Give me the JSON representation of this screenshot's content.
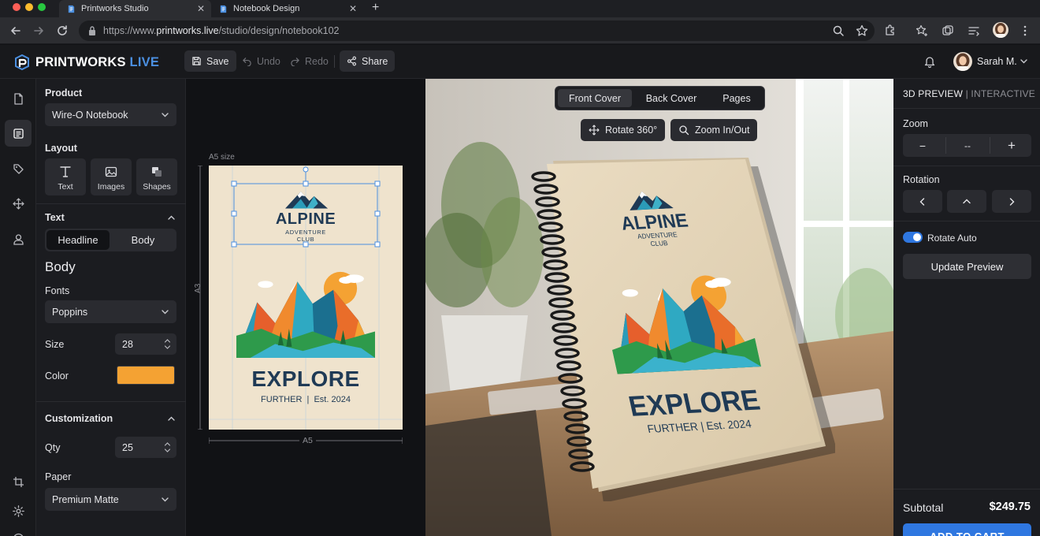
{
  "browser": {
    "tabs": [
      {
        "title": "Printworks Studio",
        "active": true
      },
      {
        "title": "Notebook Design",
        "active": false
      }
    ],
    "url_prefix": "https://www.",
    "url_host": "printworks.live",
    "url_path": "/studio/design/notebook102"
  },
  "header": {
    "logo_main": "PRINTWORKS",
    "logo_accent": "LIVE",
    "save": "Save",
    "undo": "Undo",
    "redo": "Redo",
    "share": "Share",
    "user_name": "Sarah M."
  },
  "props": {
    "product_label": "Product",
    "product_value": "Wire-O Notebook",
    "layout_label": "Layout",
    "tools": [
      "Text",
      "Images",
      "Shapes"
    ],
    "text_label": "Text",
    "segments": [
      "Headline",
      "Body"
    ],
    "selected_segment": "Headline",
    "style_heading": "Body",
    "fonts_label": "Fonts",
    "font_value": "Poppins",
    "size_label": "Size",
    "size_value": "28",
    "color_label": "Color",
    "color_value": "#f4a233",
    "customization_label": "Customization",
    "qty_label": "Qty",
    "qty_value": "25",
    "paper_label": "Paper",
    "paper_value": "Premium Matte"
  },
  "canvas": {
    "size_caption": "A5 size",
    "height_label": "A3",
    "width_label": "A5"
  },
  "design": {
    "brand_line1": "ALPINE",
    "brand_line2": "ADVENTURE",
    "brand_line3": "CLUB",
    "headline": "EXPLORE",
    "tagline": "FURTHER  |  Est. 2024"
  },
  "stage": {
    "view_tabs": [
      "Front Cover",
      "Back Cover",
      "Pages"
    ],
    "selected_view": "Front Cover",
    "rotate_button": "Rotate 360°",
    "zoom_button": "Zoom In/Out"
  },
  "preview_panel": {
    "title": "3D PREVIEW",
    "subtitle": "INTERACTIVE",
    "zoom_label": "Zoom",
    "zoom_minus": "−",
    "zoom_value": "--",
    "zoom_plus": "+",
    "rotation_label": "Rotation",
    "rotate_auto_label": "Rotate Auto",
    "rotate_auto_on": true,
    "update_button": "Update Preview",
    "subtotal_label": "Subtotal",
    "subtotal_value": "$249.75",
    "cart_button": "ADD TO CART"
  },
  "colors": {
    "accent": "#2f77e0",
    "logo_accent": "#4b8fe0",
    "swatch": "#f4a233"
  }
}
